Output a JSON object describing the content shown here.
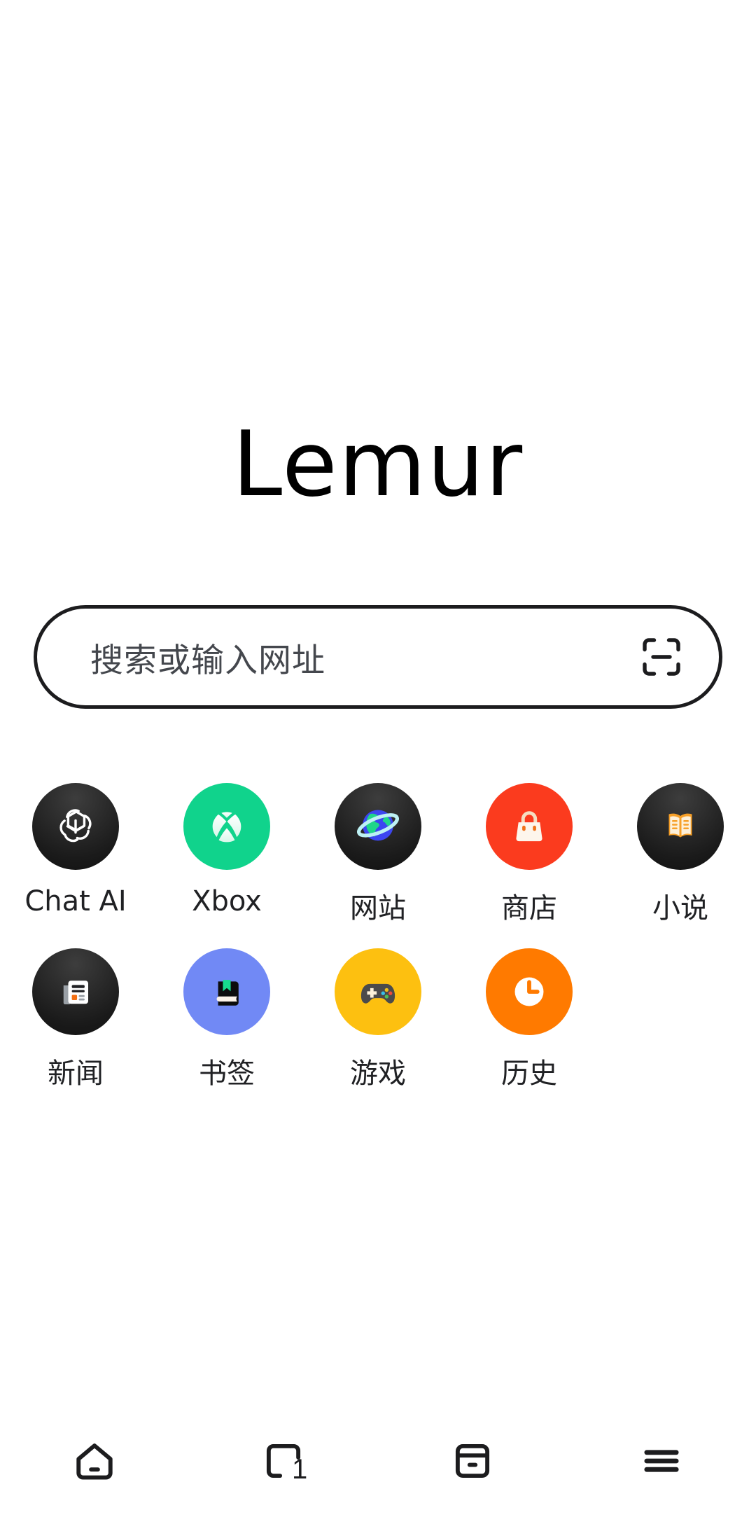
{
  "app": {
    "brand": "Lemur",
    "background_color": "#ffffff",
    "ink_color": "#1c1c1e"
  },
  "search": {
    "placeholder": "搜索或输入网址",
    "value": "",
    "scan_icon": "scan-code-icon"
  },
  "shortcuts": [
    {
      "label": "Chat AI",
      "icon": "openai-logo-icon",
      "bg": "#2b2b2b"
    },
    {
      "label": "Xbox",
      "icon": "xbox-logo-icon",
      "bg": "#10d38c"
    },
    {
      "label": "网站",
      "icon": "globe-planet-icon",
      "bg": "#2b2b2b"
    },
    {
      "label": "商店",
      "icon": "handbag-icon",
      "bg": "#fb3b1e"
    },
    {
      "label": "小说",
      "icon": "open-book-icon",
      "bg": "#2b2b2b"
    },
    {
      "label": "新闻",
      "icon": "newspaper-icon",
      "bg": "#2b2b2b"
    },
    {
      "label": "书签",
      "icon": "bookmark-book-icon",
      "bg": "#7189f5"
    },
    {
      "label": "游戏",
      "icon": "gamepad-icon",
      "bg": "#fdc010"
    },
    {
      "label": "历史",
      "icon": "clock-icon",
      "bg": "#ff7a00"
    }
  ],
  "bottom_nav": [
    {
      "name": "home",
      "icon": "home-icon",
      "badge": ""
    },
    {
      "name": "tabs",
      "icon": "tabs-icon",
      "badge": "1"
    },
    {
      "name": "bookmarks",
      "icon": "archive-icon",
      "badge": ""
    },
    {
      "name": "menu",
      "icon": "hamburger-icon",
      "badge": ""
    }
  ]
}
